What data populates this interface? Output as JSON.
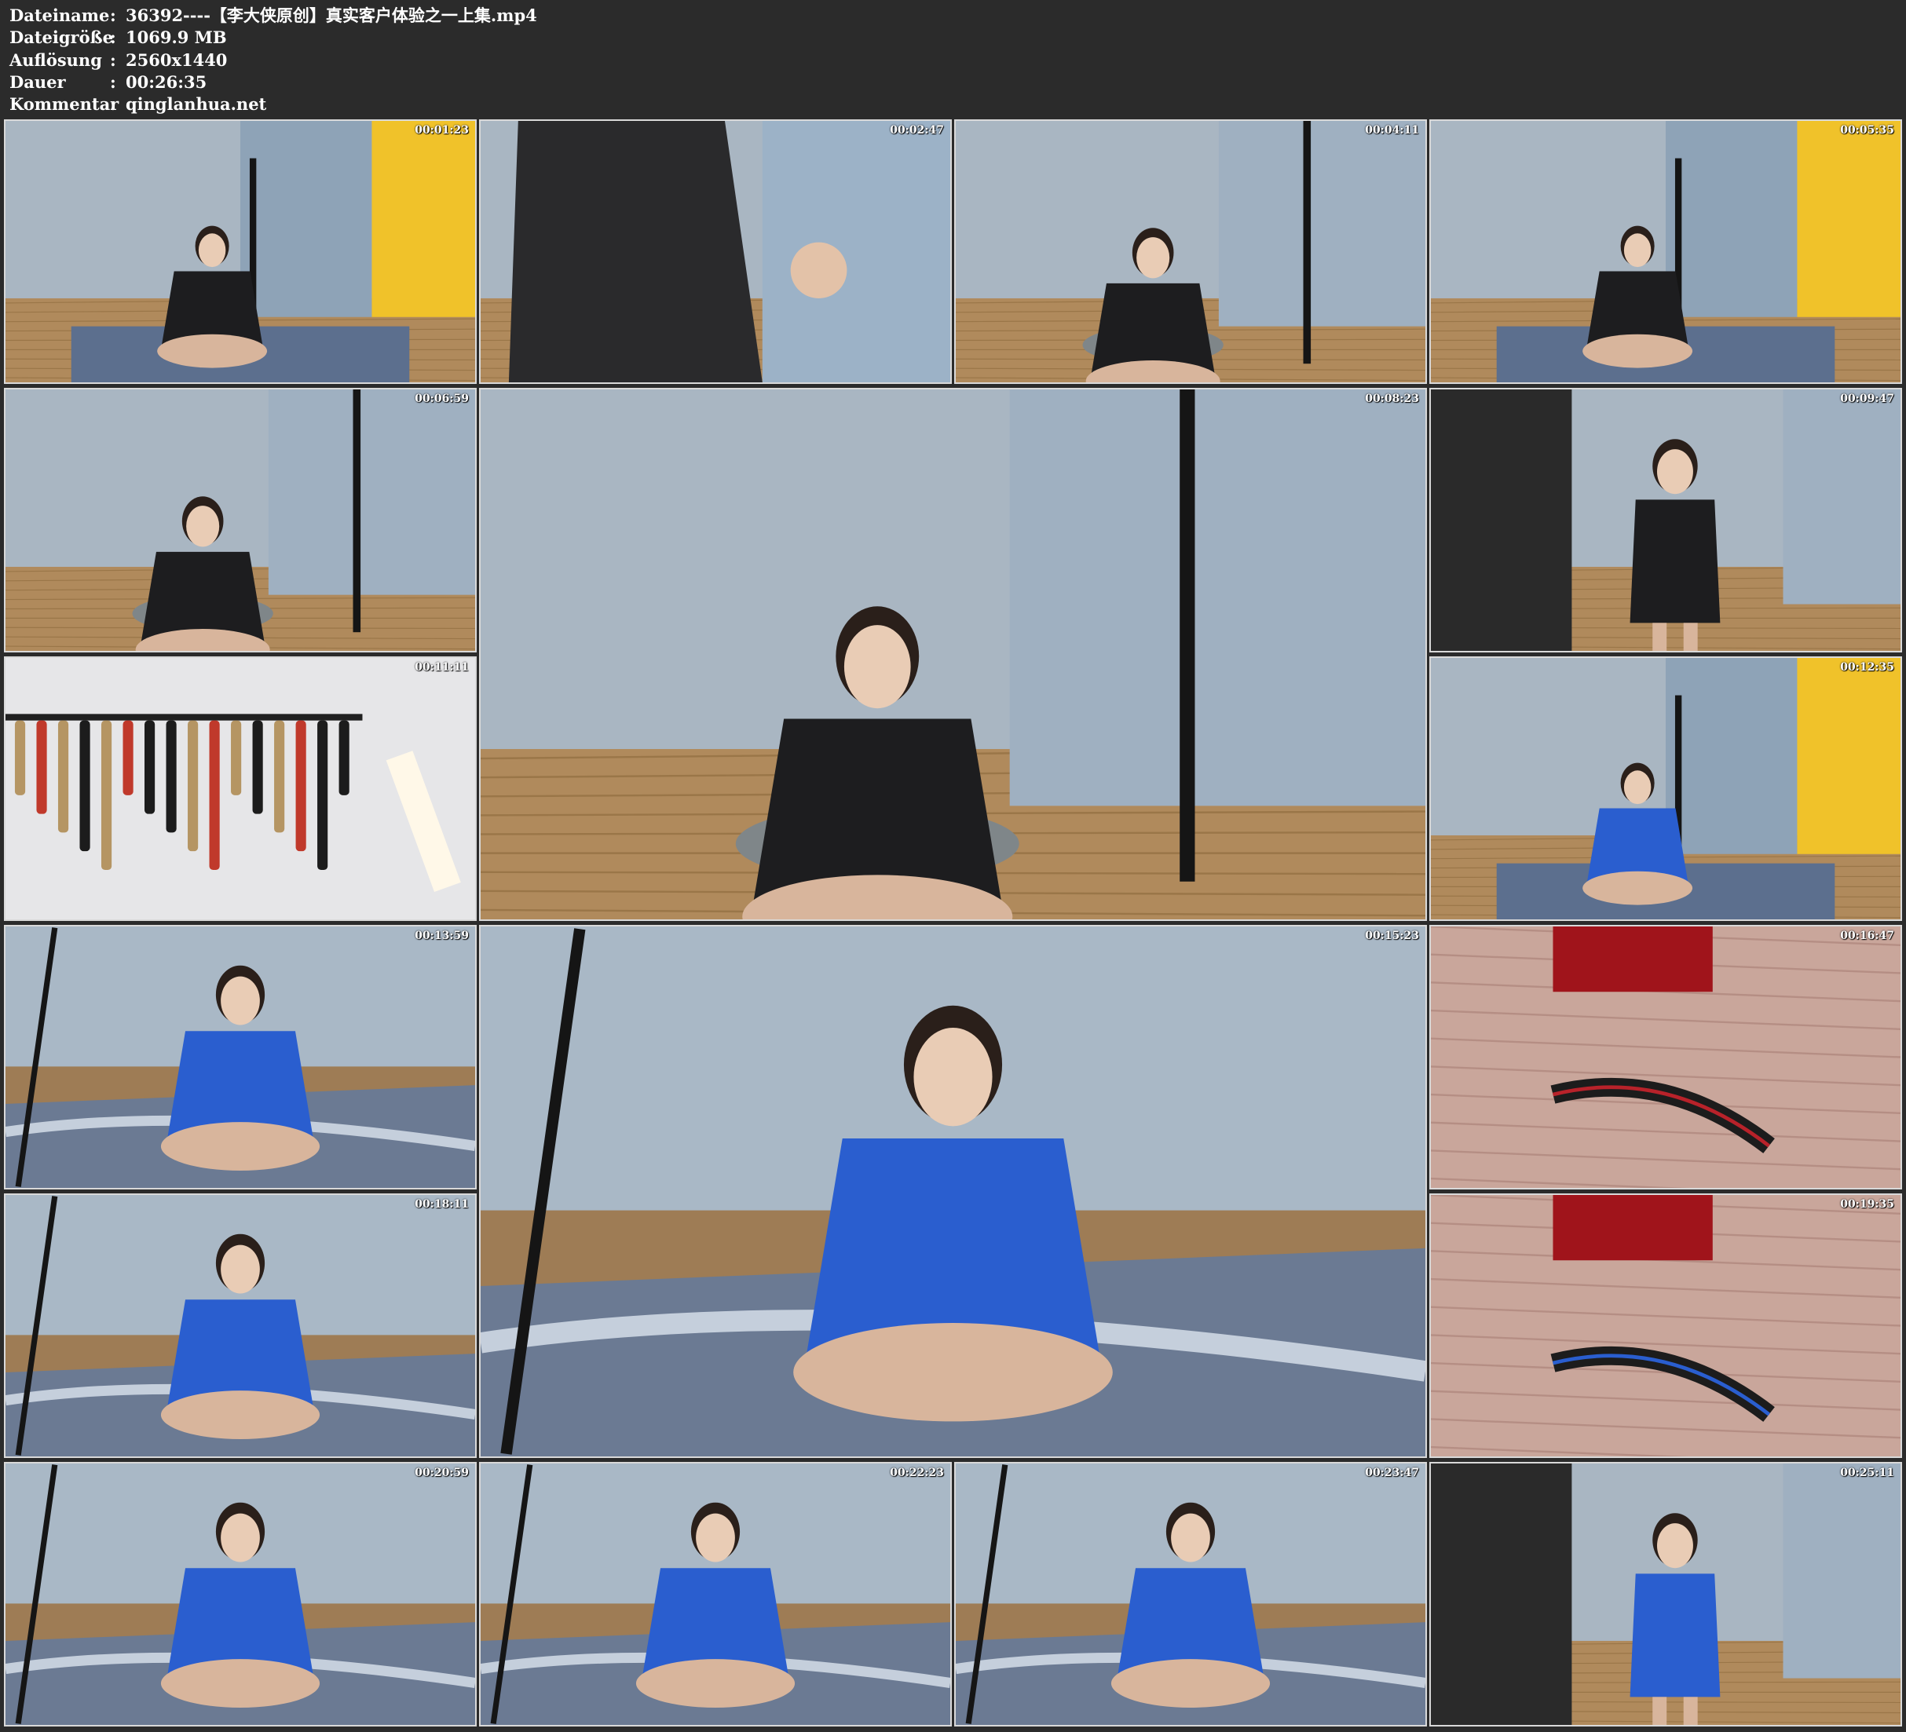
{
  "meta": {
    "rows": [
      {
        "key": "Dateiname",
        "sep": ":",
        "value": "36392----【李大侠原创】真实客户体验之一上集.mp4"
      },
      {
        "key": "Dateigröße",
        "sep": ":",
        "value": "1069.9 MB"
      },
      {
        "key": "Auflösung",
        "sep": ":",
        "value": "2560x1440"
      },
      {
        "key": "Dauer",
        "sep": ":",
        "value": "00:26:35"
      },
      {
        "key": "Kommentar",
        "sep": ":",
        "value": "qinglanhua.net"
      }
    ]
  },
  "frames": [
    {
      "timestamp": "00:01:23",
      "scene": "curtain-yellow",
      "uniform": "#1d1d1f"
    },
    {
      "timestamp": "00:02:47",
      "scene": "closeup-jacket",
      "uniform": "#2a2a2c"
    },
    {
      "timestamp": "00:04:11",
      "scene": "kneel-suit",
      "uniform": "#1d1d1f"
    },
    {
      "timestamp": "00:05:35",
      "scene": "curtain-yellow",
      "uniform": "#1d1d1f"
    },
    {
      "timestamp": "00:06:59",
      "scene": "kneel-suit",
      "uniform": "#1d1d1f"
    },
    {
      "timestamp": "00:08:23",
      "scene": "kneel-suit",
      "uniform": "#1d1d1f"
    },
    {
      "timestamp": "00:09:47",
      "scene": "stand-room",
      "uniform": "#1d1d1f"
    },
    {
      "timestamp": "00:11:11",
      "scene": "rope-wall",
      "uniform": "#b59563"
    },
    {
      "timestamp": "00:12:35",
      "scene": "curtain-yellow",
      "uniform": "#2a5ecf"
    },
    {
      "timestamp": "00:13:59",
      "scene": "floor-mat",
      "uniform": "#2a5ecf"
    },
    {
      "timestamp": "00:15:23",
      "scene": "floor-mat",
      "uniform": "#2a5ecf"
    },
    {
      "timestamp": "00:16:47",
      "scene": "carpet-items",
      "uniform": "#b8222a"
    },
    {
      "timestamp": "00:18:11",
      "scene": "floor-mat",
      "uniform": "#2a5ecf"
    },
    {
      "timestamp": "00:19:35",
      "scene": "carpet-items",
      "uniform": "#2a5ecf"
    },
    {
      "timestamp": "00:20:59",
      "scene": "floor-mat",
      "uniform": "#2a5ecf"
    },
    {
      "timestamp": "00:22:23",
      "scene": "floor-mat",
      "uniform": "#2a5ecf"
    },
    {
      "timestamp": "00:23:47",
      "scene": "floor-mat",
      "uniform": "#2a5ecf"
    },
    {
      "timestamp": "00:25:11",
      "scene": "stand-room",
      "uniform": "#2a5ecf"
    }
  ]
}
